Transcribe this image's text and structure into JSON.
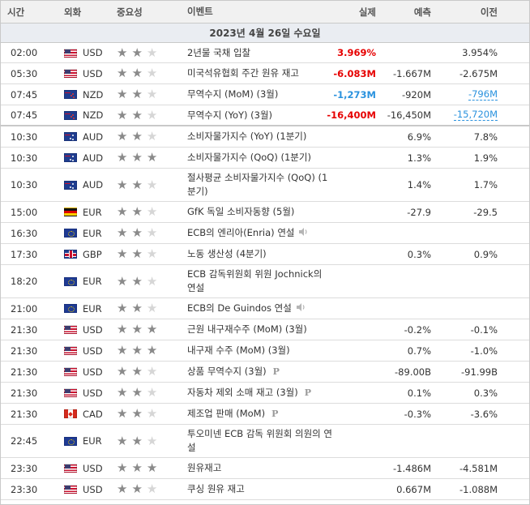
{
  "header": {
    "time": "시간",
    "currency": "외화",
    "importance": "중요성",
    "event": "이벤트",
    "actual": "실제",
    "forecast": "예측",
    "previous": "이전"
  },
  "date_label": "2023년 4월 26일 수요일",
  "events": [
    {
      "time": "02:00",
      "flag": "usd-flag-icon",
      "currency": "USD",
      "stars": 2,
      "event": "2년물 국채 입찰",
      "actual": "3.969%",
      "actual_color": "#e60000",
      "forecast": "",
      "previous": "3.954%"
    },
    {
      "time": "05:30",
      "flag": "usd-flag-icon",
      "currency": "USD",
      "stars": 2,
      "event": "미국석유협회 주간 원유 재고",
      "actual": "-6.083M",
      "actual_color": "#e60000",
      "forecast": "-1.667M",
      "previous": "-2.675M"
    },
    {
      "time": "07:45",
      "flag": "nzd-flag-icon",
      "currency": "NZD",
      "stars": 2,
      "event": "무역수지 (MoM) (3월)",
      "actual": "-1,273M",
      "actual_color": "#2a92de",
      "forecast": "-920M",
      "previous": "-796M",
      "previous_revised": true
    },
    {
      "time": "07:45",
      "flag": "nzd-flag-icon",
      "currency": "NZD",
      "stars": 2,
      "event": "무역수지 (YoY) (3월)",
      "actual": "-16,400M",
      "actual_color": "#e60000",
      "forecast": "-16,450M",
      "previous": "-15,720M",
      "previous_revised": true
    },
    {
      "time": "10:30",
      "flag": "aud-flag-icon",
      "currency": "AUD",
      "stars": 2,
      "event": "소비자물가지수 (YoY) (1분기)",
      "actual": "",
      "forecast": "6.9%",
      "previous": "7.8%"
    },
    {
      "time": "10:30",
      "flag": "aud-flag-icon",
      "currency": "AUD",
      "stars": 3,
      "event": "소비자물가지수 (QoQ) (1분기)",
      "actual": "",
      "forecast": "1.3%",
      "previous": "1.9%"
    },
    {
      "time": "10:30",
      "flag": "aud-flag-icon",
      "currency": "AUD",
      "stars": 2,
      "event": "절사평균 소비자물가지수 (QoQ) (1분기)",
      "actual": "",
      "forecast": "1.4%",
      "previous": "1.7%"
    },
    {
      "time": "15:00",
      "flag": "ger-flag-icon",
      "currency": "EUR",
      "stars": 2,
      "event": "GfK 독일 소비자동향 (5월)",
      "actual": "",
      "forecast": "-27.9",
      "previous": "-29.5"
    },
    {
      "time": "16:30",
      "flag": "eur-flag-icon",
      "currency": "EUR",
      "stars": 2,
      "event": "ECB의 엔리아(Enria) 연설",
      "speech": true,
      "actual": "",
      "forecast": "",
      "previous": ""
    },
    {
      "time": "17:30",
      "flag": "gbp-flag-icon",
      "currency": "GBP",
      "stars": 2,
      "event": "노동 생산성 (4분기)",
      "actual": "",
      "forecast": "0.3%",
      "previous": "0.9%"
    },
    {
      "time": "18:20",
      "flag": "eur-flag-icon",
      "currency": "EUR",
      "stars": 2,
      "event": "ECB 감독위원회 위원 Jochnick의 연설",
      "actual": "",
      "forecast": "",
      "previous": ""
    },
    {
      "time": "21:00",
      "flag": "eur-flag-icon",
      "currency": "EUR",
      "stars": 2,
      "event": "ECB의 De Guindos 연설",
      "speech": true,
      "actual": "",
      "forecast": "",
      "previous": ""
    },
    {
      "time": "21:30",
      "flag": "usd-flag-icon",
      "currency": "USD",
      "stars": 3,
      "event": "근원 내구재수주 (MoM) (3월)",
      "actual": "",
      "forecast": "-0.2%",
      "previous": "-0.1%"
    },
    {
      "time": "21:30",
      "flag": "usd-flag-icon",
      "currency": "USD",
      "stars": 3,
      "event": "내구재 수주 (MoM) (3월)",
      "actual": "",
      "forecast": "0.7%",
      "previous": "-1.0%"
    },
    {
      "time": "21:30",
      "flag": "usd-flag-icon",
      "currency": "USD",
      "stars": 2,
      "event": "상품 무역수지 (3월)",
      "preliminary": true,
      "actual": "",
      "forecast": "-89.00B",
      "previous": "-91.99B"
    },
    {
      "time": "21:30",
      "flag": "usd-flag-icon",
      "currency": "USD",
      "stars": 2,
      "event": "자동차 제외 소매 재고 (3월)",
      "preliminary": true,
      "actual": "",
      "forecast": "0.1%",
      "previous": "0.3%"
    },
    {
      "time": "21:30",
      "flag": "cad-flag-icon",
      "currency": "CAD",
      "stars": 2,
      "event": "제조업 판매 (MoM)",
      "preliminary": true,
      "actual": "",
      "forecast": "-0.3%",
      "previous": "-3.6%"
    },
    {
      "time": "22:45",
      "flag": "eur-flag-icon",
      "currency": "EUR",
      "stars": 2,
      "event": "투오미넨 ECB 감독 위원회 의원의 연설",
      "actual": "",
      "forecast": "",
      "previous": ""
    },
    {
      "time": "23:30",
      "flag": "usd-flag-icon",
      "currency": "USD",
      "stars": 3,
      "event": "원유재고",
      "actual": "",
      "forecast": "-1.486M",
      "previous": "-4.581M"
    },
    {
      "time": "23:30",
      "flag": "usd-flag-icon",
      "currency": "USD",
      "stars": 2,
      "event": "쿠싱 원유 재고",
      "actual": "",
      "forecast": "0.667M",
      "previous": "-1.088M"
    }
  ],
  "preliminary_mark": "P"
}
